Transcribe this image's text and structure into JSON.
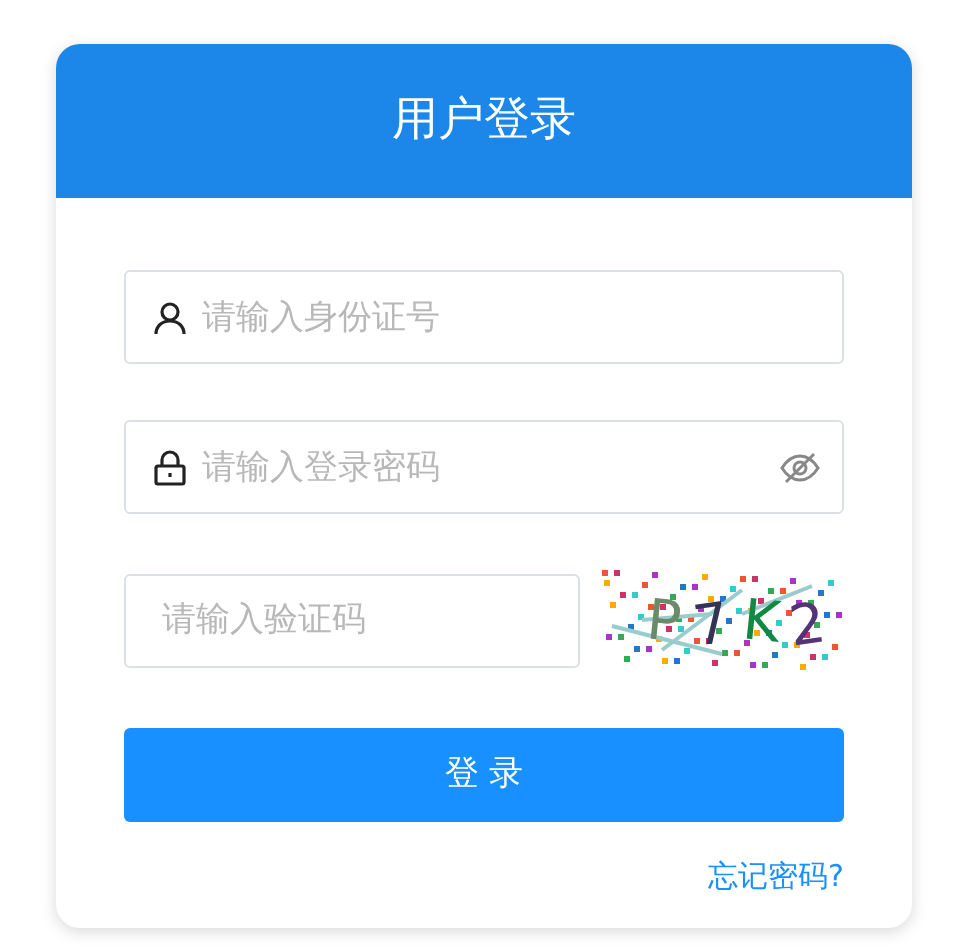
{
  "title": "用户登录",
  "fields": [
    {
      "kind": "id",
      "placeholder": "请输入身份证号"
    },
    {
      "kind": "password",
      "placeholder": "请输入登录密码"
    },
    {
      "kind": "captcha",
      "placeholder": "请输入验证码",
      "captcha_text": "P7K2"
    }
  ],
  "submit": "登 录",
  "forgot_link": "忘记密码?"
}
